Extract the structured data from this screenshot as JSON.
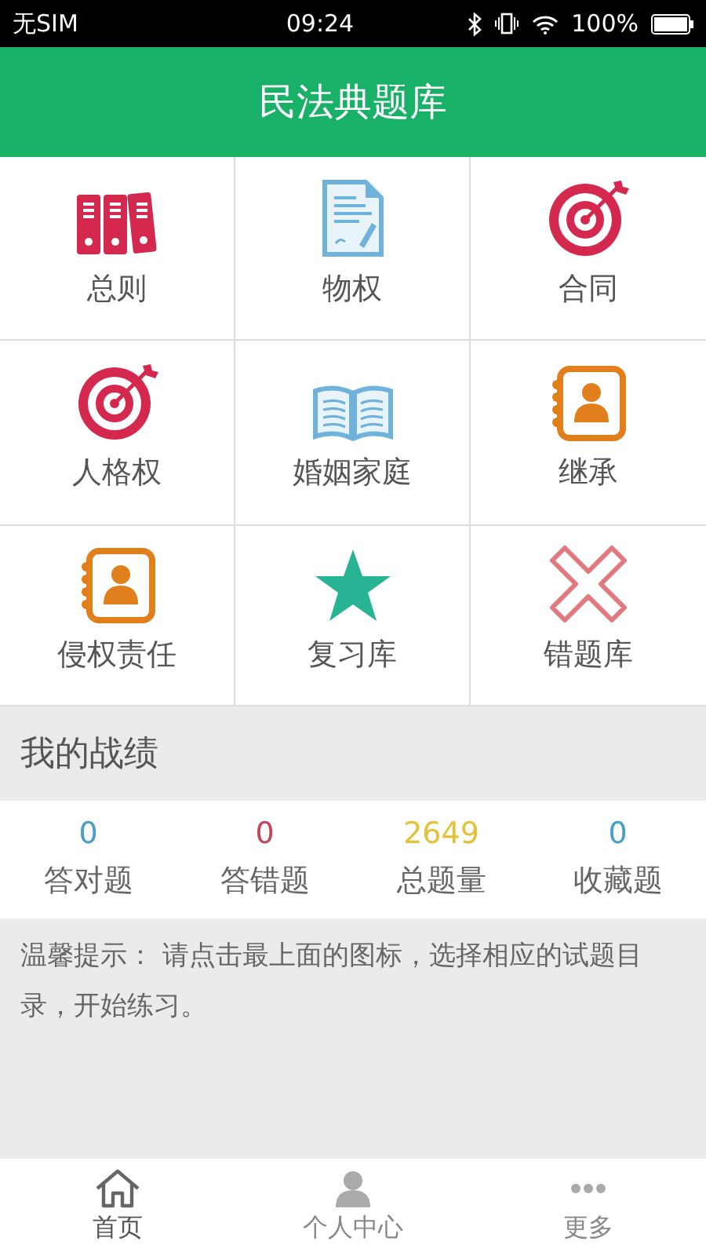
{
  "status_bar": {
    "carrier": "无SIM",
    "time": "09:24",
    "battery": "100%"
  },
  "header": {
    "title": "民法典题库"
  },
  "grid": [
    {
      "kind": "binders",
      "label": "总则"
    },
    {
      "kind": "document",
      "label": "物权"
    },
    {
      "kind": "target",
      "label": "合同"
    },
    {
      "kind": "target",
      "label": "人格权"
    },
    {
      "kind": "book",
      "label": "婚姻家庭"
    },
    {
      "kind": "contact",
      "label": "继承"
    },
    {
      "kind": "contact",
      "label": "侵权责任"
    },
    {
      "kind": "star",
      "label": "复习库"
    },
    {
      "kind": "cross",
      "label": "错题库"
    }
  ],
  "record": {
    "title": "我的战绩",
    "stats": [
      {
        "value": "0",
        "label": "答对题",
        "color": "#4a9fc7"
      },
      {
        "value": "0",
        "label": "答错题",
        "color": "#c0485a"
      },
      {
        "value": "2649",
        "label": "总题量",
        "color": "#e3c139"
      },
      {
        "value": "0",
        "label": "收藏题",
        "color": "#4a9fc7"
      }
    ]
  },
  "tip": "温馨提示： 请点击最上面的图标，选择相应的试题目录，开始练习。",
  "tab_bar": [
    {
      "label": "首页",
      "selected": true
    },
    {
      "label": "个人中心",
      "selected": false
    },
    {
      "label": "更多",
      "selected": false
    }
  ]
}
